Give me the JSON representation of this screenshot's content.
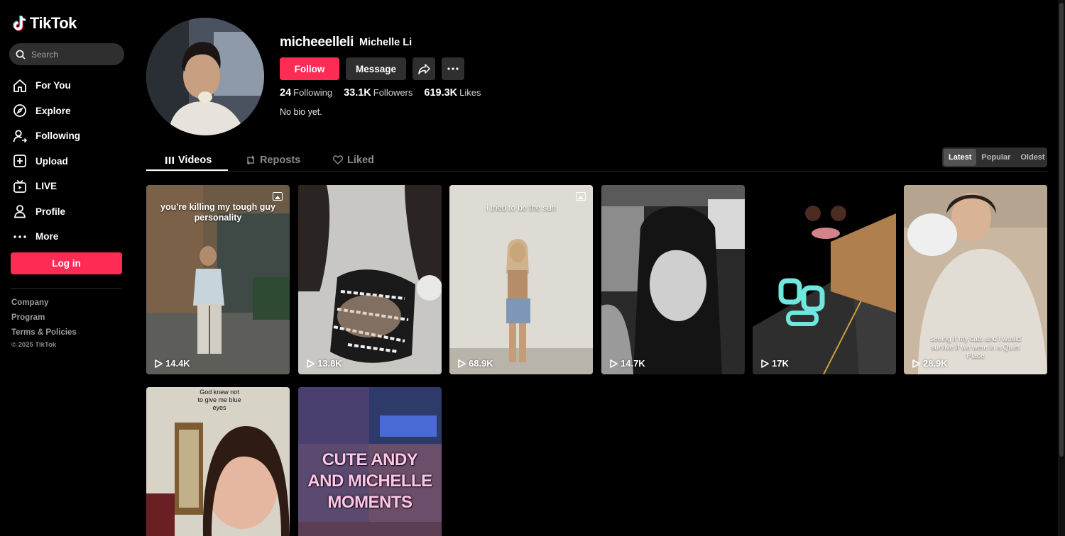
{
  "brand": {
    "name": "TikTok",
    "accent": "#fe2c55"
  },
  "search": {
    "placeholder": "Search"
  },
  "nav": {
    "items": [
      {
        "label": "For You",
        "icon": "home-icon"
      },
      {
        "label": "Explore",
        "icon": "compass-icon"
      },
      {
        "label": "Following",
        "icon": "user-follow-icon"
      },
      {
        "label": "Upload",
        "icon": "upload-icon"
      },
      {
        "label": "LIVE",
        "icon": "live-icon"
      },
      {
        "label": "Profile",
        "icon": "profile-icon"
      },
      {
        "label": "More",
        "icon": "more-dots-icon"
      }
    ]
  },
  "login": {
    "label": "Log in"
  },
  "footer": {
    "links": [
      "Company",
      "Program",
      "Terms & Policies"
    ],
    "copyright": "© 2025 TikTok"
  },
  "profile": {
    "username": "micheeelleli",
    "nickname": "Michelle Li",
    "follow_label": "Follow",
    "message_label": "Message",
    "stats": {
      "following": {
        "value": "24",
        "label": "Following"
      },
      "followers": {
        "value": "33.1K",
        "label": "Followers"
      },
      "likes": {
        "value": "619.3K",
        "label": "Likes"
      }
    },
    "bio": "No bio yet."
  },
  "tabs": {
    "videos": "Videos",
    "reposts": "Reposts",
    "liked": "Liked"
  },
  "sort": {
    "latest": "Latest",
    "popular": "Popular",
    "oldest": "Oldest",
    "active": "Latest"
  },
  "videos": [
    {
      "views": "14.4K",
      "caption": "you're killing my tough guy personality",
      "photo": true
    },
    {
      "views": "13.8K",
      "caption": "",
      "photo": false
    },
    {
      "views": "68.9K",
      "caption": "i tried to be the sun",
      "photo": true
    },
    {
      "views": "14.7K",
      "caption": "",
      "photo": false
    },
    {
      "views": "17K",
      "caption": "",
      "photo": false
    },
    {
      "views": "28.9K",
      "caption": "seeing if my cats and i would survive if we were in a Quiet Place",
      "photo": false
    },
    {
      "views": "",
      "caption": "God knew not to give me blue eyes",
      "photo": false
    },
    {
      "views": "",
      "caption": "CUTE ANDY AND MICHELLE MOMENTS",
      "photo": false
    }
  ]
}
